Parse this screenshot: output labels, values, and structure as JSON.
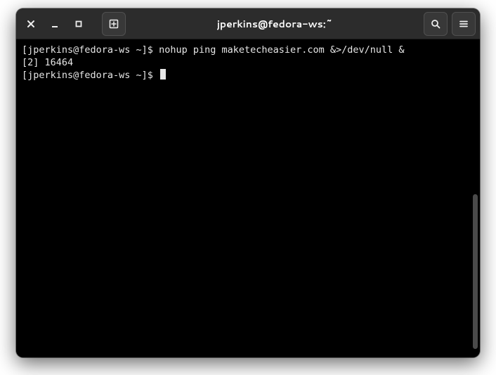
{
  "titlebar": {
    "title": "jperkins@fedora-ws:~"
  },
  "terminal": {
    "lines": [
      "[jperkins@fedora-ws ~]$ nohup ping maketecheasier.com &>/dev/null &",
      "[2] 16464",
      "[jperkins@fedora-ws ~]$ "
    ]
  }
}
